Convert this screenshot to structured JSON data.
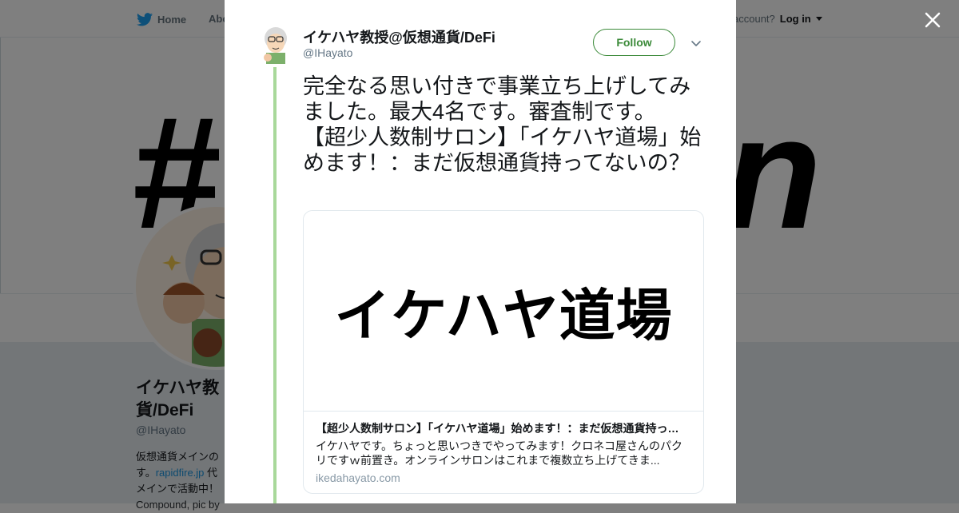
{
  "topbar": {
    "home_label": "Home",
    "about_label": "Abo",
    "login_prefix": "account?",
    "login_label": "Log in"
  },
  "profile": {
    "name": "イケハヤ教\n貨/DeFi",
    "handle": "@IHayato",
    "bio_line1": "仮想通貨メインの",
    "bio_line2a": "す。",
    "bio_link": "rapidfire.jp",
    "bio_line2b": " 代",
    "bio_line3": "メインで活動中！",
    "bio_line4": "Compound, pic by"
  },
  "tweet": {
    "author_name": "イケハヤ教授@仮想通貨/DeFi",
    "author_handle": "@IHayato",
    "follow_label": "Follow",
    "text": "完全なる思い付きで事業立ち上げしてみました。最大4名です。審査制です。\n【超少人数制サロン】「イケハヤ道場」始めます！：まだ仮想通貨持ってないの？"
  },
  "card": {
    "image_text": "イケハヤ道場",
    "title": "【超少人数制サロン】「イケハヤ道場」始めます！：まだ仮想通貨持っ…",
    "description": "イケハヤです。ちょっと思いつきでやってみます！クロネコ屋さんのパクリですｗ前置き。オンラインサロンはこれまで複数立ち上げてきま...",
    "domain": "ikedahayato.com"
  },
  "banner": {
    "left_glyph": "#",
    "right_glyph": "n"
  },
  "colors": {
    "follow_accent": "#3b8a39",
    "thread_line": "#a8d89a",
    "overlay": "rgba(0,0,0,0.5)"
  },
  "icons": {
    "home": "twitter-bird-icon",
    "close": "close-icon",
    "caret": "chevron-down-icon"
  }
}
